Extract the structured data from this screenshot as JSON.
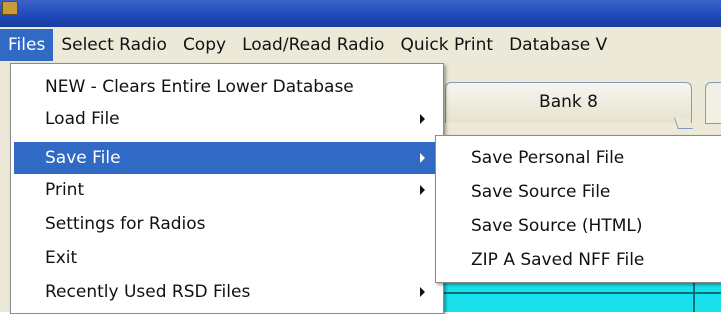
{
  "menubar": {
    "items": [
      "Files",
      "Select Radio",
      "Copy",
      "Load/Read Radio",
      "Quick Print",
      "Database V"
    ],
    "active": "Files"
  },
  "tabs": {
    "bank": "Bank 8"
  },
  "files_menu": {
    "items": [
      {
        "label": "NEW - Clears Entire Lower Database",
        "has_submenu": false
      },
      {
        "label": "Load File",
        "has_submenu": true
      },
      {
        "label": "Save File",
        "has_submenu": true,
        "highlighted": true
      },
      {
        "label": "Print",
        "has_submenu": true
      },
      {
        "label": "Settings for Radios",
        "has_submenu": false
      },
      {
        "label": "Exit",
        "has_submenu": false
      },
      {
        "label": "Recently Used  RSD Files",
        "has_submenu": true
      }
    ]
  },
  "save_file_submenu": {
    "items": [
      "Save Personal File",
      "Save Source File",
      "Save Source (HTML)",
      "ZIP A Saved NFF File"
    ]
  },
  "colors": {
    "highlight": "#316ac5",
    "grid_fill": "#19e1ec",
    "title_bar": "#1f49b8",
    "menu_bg": "#ece9d8"
  }
}
